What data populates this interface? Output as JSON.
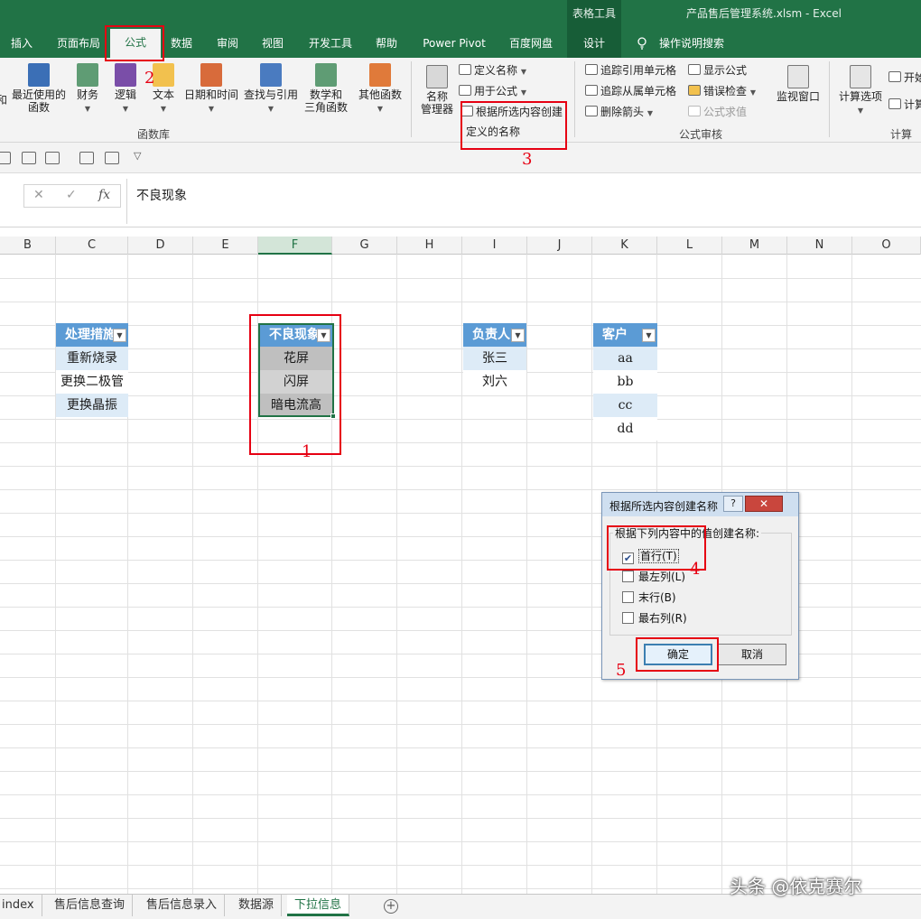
{
  "title_bar": {
    "contextual_label": "表格工具",
    "doc_title": "产品售后管理系统.xlsm - Excel"
  },
  "tabs": [
    {
      "label": "插入"
    },
    {
      "label": "页面布局"
    },
    {
      "label": "公式",
      "active": true
    },
    {
      "label": "数据"
    },
    {
      "label": "审阅"
    },
    {
      "label": "视图"
    },
    {
      "label": "开发工具"
    },
    {
      "label": "帮助"
    },
    {
      "label": "Power Pivot"
    },
    {
      "label": "百度网盘"
    },
    {
      "label": "设计"
    }
  ],
  "tell_me": "操作说明搜索",
  "ribbon": {
    "function_library": {
      "partial_left": "和",
      "recent": "最近使用的\n函数",
      "financial": "财务",
      "logical": "逻辑",
      "text": "文本",
      "datetime": "日期和时间",
      "lookup": "查找与引用",
      "math": "数学和\n三角函数",
      "other": "其他函数",
      "group_label": "函数库"
    },
    "defined_names": {
      "name_manager": "名称\n管理器",
      "define_name": "定义名称",
      "use_in_formula": "用于公式",
      "create_from_selection_1": "根据所选内容创建",
      "create_from_selection_2": "定义的名称"
    },
    "formula_auditing": {
      "trace_precedents": "追踪引用单元格",
      "trace_dependents": "追踪从属单元格",
      "remove_arrows": "删除箭头",
      "show_formulas": "显示公式",
      "error_checking": "错误检查",
      "evaluate_formula": "公式求值",
      "watch_window": "监视窗口",
      "group_label": "公式审核"
    },
    "calculation": {
      "calc_options": "计算选项",
      "calc_now_partial": "开始",
      "calc_sheet_partial": "计算",
      "group_label": "计算"
    }
  },
  "formula_bar": {
    "cancel": "✕",
    "enter": "✓",
    "fx": "fx",
    "value": "不良现象"
  },
  "columns": [
    "B",
    "C",
    "D",
    "E",
    "F",
    "G",
    "H",
    "I",
    "J",
    "K",
    "L",
    "M",
    "N",
    "O"
  ],
  "selected_column": "F",
  "tables": {
    "measures": {
      "header": "处理措施",
      "rows": [
        "重新烧录",
        "更换二极管",
        "更换晶振"
      ]
    },
    "defects": {
      "header": "不良现象",
      "rows": [
        "花屏",
        "闪屏",
        "暗电流高"
      ]
    },
    "owner": {
      "header": "负责人",
      "rows": [
        "张三",
        "刘六"
      ]
    },
    "customer": {
      "header": "客户",
      "rows": [
        "aa",
        "bb",
        "cc",
        "dd"
      ]
    }
  },
  "annotations": [
    "1",
    "2",
    "3",
    "4",
    "5"
  ],
  "dialog": {
    "title": "根据所选内容创建名称",
    "help": "?",
    "close": "✕",
    "group_label": "根据下列内容中的值创建名称:",
    "options": [
      {
        "label": "首行(T)",
        "checked": true
      },
      {
        "label": "最左列(L)",
        "checked": false
      },
      {
        "label": "末行(B)",
        "checked": false
      },
      {
        "label": "最右列(R)",
        "checked": false
      }
    ],
    "ok": "确定",
    "cancel": "取消"
  },
  "sheet_tabs": [
    {
      "label": "index"
    },
    {
      "label": "售后信息查询"
    },
    {
      "label": "售后信息录入"
    },
    {
      "label": "数据源"
    },
    {
      "label": "下拉信息",
      "active": true
    }
  ],
  "add_sheet": "+",
  "watermark": "头条 @依克赛尔",
  "colors": {
    "excel_green": "#217346",
    "table_header": "#5b9bd5",
    "table_band": "#ddebf7",
    "annotation_red": "#e60012"
  }
}
